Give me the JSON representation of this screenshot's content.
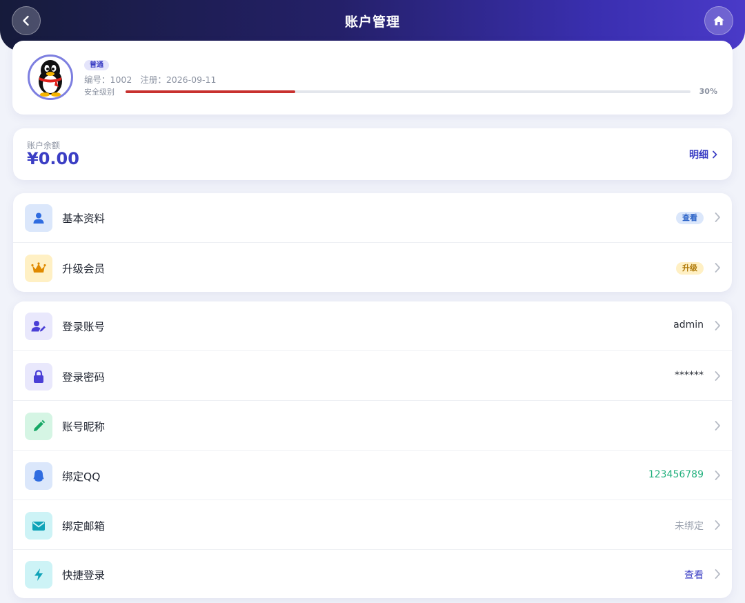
{
  "header": {
    "title": "账户管理"
  },
  "profile": {
    "level_badge": "普通",
    "id_text": "编号：1002",
    "register_text": "注册：2026-09-11",
    "security_label": "安全级别",
    "security_percent_text": "30%",
    "security_level": 0.3,
    "security_color": "#c8312f"
  },
  "balance": {
    "label": "账户余额",
    "value": "¥0.00",
    "detail_label": "明细"
  },
  "group1": [
    {
      "icon": "user-icon",
      "label": "基本资料",
      "pill": "查看",
      "pill_bg": "#dbe7fb",
      "pill_color": "#2a62c7"
    },
    {
      "icon": "crown-icon",
      "label": "升级会员",
      "pill": "升级",
      "pill_bg": "#fff0c4",
      "pill_color": "#b07a0a"
    }
  ],
  "group2": [
    {
      "icon": "user-edit-icon",
      "label": "登录账号",
      "value": "admin"
    },
    {
      "icon": "lock-icon",
      "label": "登录密码",
      "value": "******"
    },
    {
      "icon": "pencil-icon",
      "label": "账号昵称",
      "value": ""
    },
    {
      "icon": "qq-icon",
      "label": "绑定QQ",
      "value": "123456789",
      "value_color": "#22b07d"
    },
    {
      "icon": "mail-icon",
      "label": "绑定邮箱",
      "value": "未绑定",
      "value_color": "#9aa1ae"
    },
    {
      "icon": "bolt-icon",
      "label": "快捷登录",
      "value": "查看",
      "value_color": "#3b3ec4"
    }
  ],
  "colors": {
    "accent": "#3b3ec4",
    "header_start": "#161b3b",
    "header_end": "#4a3ac8"
  }
}
